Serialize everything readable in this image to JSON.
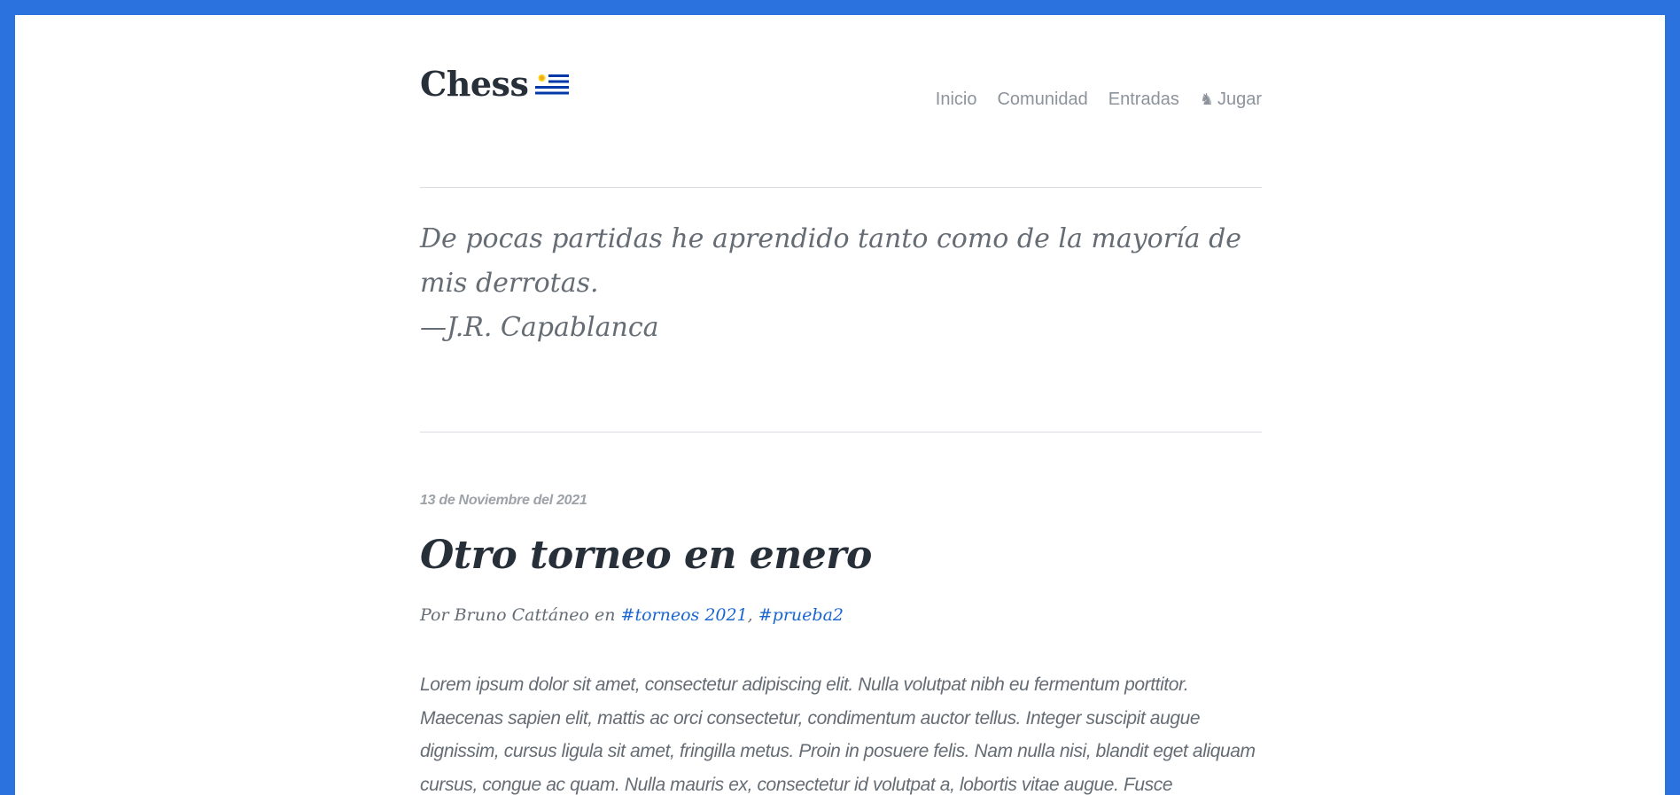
{
  "site": {
    "brand": "Chess",
    "flag_icon": "uruguay-flag-icon"
  },
  "nav": {
    "items": [
      "Inicio",
      "Comunidad",
      "Entradas"
    ],
    "play_label": "Jugar",
    "play_icon": "chess-knight-icon"
  },
  "quote": {
    "text": "De pocas partidas he aprendido tanto como de la mayoría de mis derrotas.",
    "author": "—J.R. Capablanca"
  },
  "post": {
    "date": "13 de Noviembre del 2021",
    "title": "Otro torneo en enero",
    "byline_prefix": "Por Bruno Cattáneo en",
    "tags": [
      "#torneos 2021",
      "#prueba2"
    ],
    "tag_separator": ",",
    "excerpt": "Lorem ipsum dolor sit amet, consectetur adipiscing elit. Nulla volutpat nibh eu fermentum porttitor. Maecenas sapien elit, mattis ac orci consectetur, condimentum auctor tellus. Integer suscipit augue dignissim, cursus ligula sit amet, fringilla metus. Proin in posuere felis. Nam nulla nisi, blandit eget aliquam cursus, congue ac quam. Nulla mauris ex, consectetur id volutpat a, lobortis vitae augue. Fusce"
  },
  "colors": {
    "frame": "#2c72de",
    "text_dark": "#272f38",
    "text_muted": "#656c74",
    "link": "#1a66d1"
  }
}
